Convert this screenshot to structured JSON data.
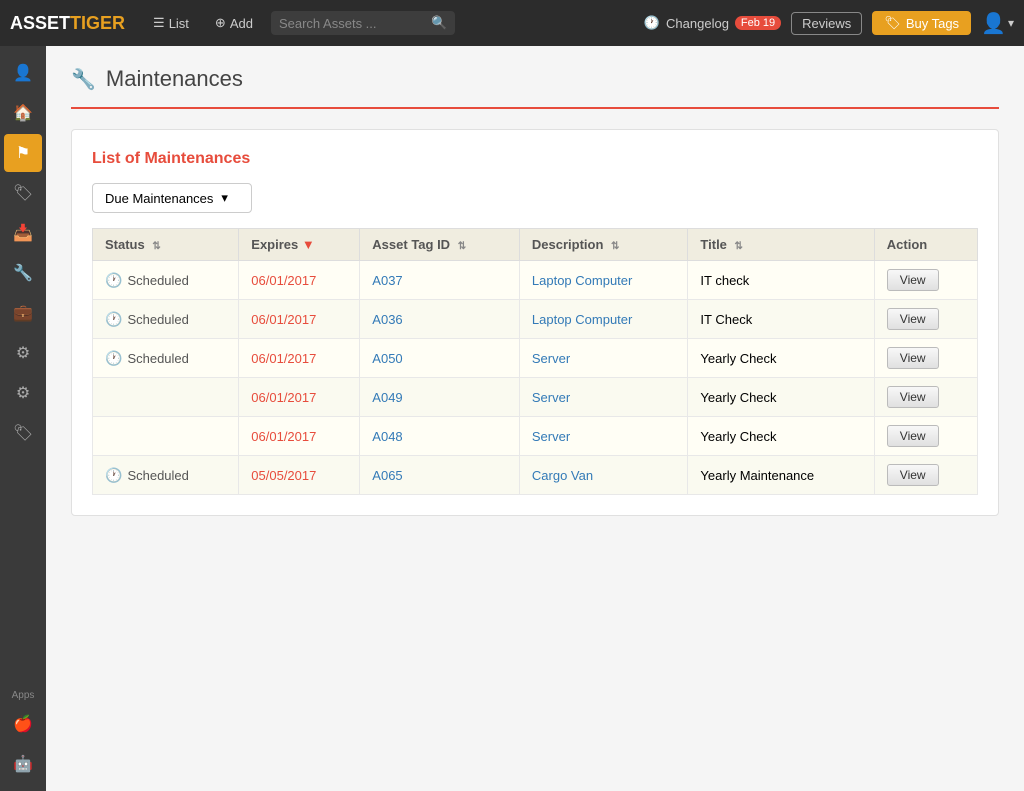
{
  "topNav": {
    "logo": {
      "part1": "ASSET",
      "part2": "TIGER"
    },
    "list_label": "List",
    "add_label": "Add",
    "search_placeholder": "Search Assets ...",
    "changelog_label": "Changelog",
    "feb_badge": "Feb 19",
    "reviews_label": "Reviews",
    "buy_tags_label": "Buy Tags"
  },
  "sidebar": {
    "icons": [
      {
        "name": "user-icon",
        "symbol": "👤",
        "active": false
      },
      {
        "name": "home-icon",
        "symbol": "🏠",
        "active": false
      },
      {
        "name": "flag-icon",
        "symbol": "⚑",
        "active": true
      },
      {
        "name": "tag-icon",
        "symbol": "🏷",
        "active": false
      },
      {
        "name": "inbox-icon",
        "symbol": "📥",
        "active": false
      },
      {
        "name": "wrench-icon",
        "symbol": "🔧",
        "active": false
      },
      {
        "name": "briefcase-icon",
        "symbol": "💼",
        "active": false
      },
      {
        "name": "settings-icon",
        "symbol": "⚙",
        "active": false
      },
      {
        "name": "gear-icon",
        "symbol": "⚙",
        "active": false
      },
      {
        "name": "label-icon",
        "symbol": "🏷",
        "active": false
      }
    ],
    "apps_label": "Apps",
    "apple_icon": "🍎",
    "android_icon": "🤖"
  },
  "page": {
    "title": "Maintenances",
    "card_title": "List of Maintenances",
    "dropdown_label": "Due Maintenances",
    "table": {
      "columns": [
        {
          "key": "status",
          "label": "Status",
          "sortable": true,
          "sort_active": false
        },
        {
          "key": "expires",
          "label": "Expires",
          "sortable": true,
          "sort_active": true
        },
        {
          "key": "asset_tag_id",
          "label": "Asset Tag ID",
          "sortable": true,
          "sort_active": false
        },
        {
          "key": "description",
          "label": "Description",
          "sortable": true,
          "sort_active": false
        },
        {
          "key": "title",
          "label": "Title",
          "sortable": true,
          "sort_active": false
        },
        {
          "key": "action",
          "label": "Action",
          "sortable": false,
          "sort_active": false
        }
      ],
      "rows": [
        {
          "status": "Scheduled",
          "has_status": true,
          "expires": "06/01/2017",
          "asset_tag_id": "A037",
          "description": "Laptop Computer",
          "title": "IT check",
          "action": "View"
        },
        {
          "status": "Scheduled",
          "has_status": true,
          "expires": "06/01/2017",
          "asset_tag_id": "A036",
          "description": "Laptop Computer",
          "title": "IT Check",
          "action": "View"
        },
        {
          "status": "Scheduled",
          "has_status": true,
          "expires": "06/01/2017",
          "asset_tag_id": "A050",
          "description": "Server",
          "title": "Yearly Check",
          "action": "View"
        },
        {
          "status": "",
          "has_status": false,
          "expires": "06/01/2017",
          "asset_tag_id": "A049",
          "description": "Server",
          "title": "Yearly Check",
          "action": "View"
        },
        {
          "status": "",
          "has_status": false,
          "expires": "06/01/2017",
          "asset_tag_id": "A048",
          "description": "Server",
          "title": "Yearly Check",
          "action": "View"
        },
        {
          "status": "Scheduled",
          "has_status": true,
          "expires": "05/05/2017",
          "asset_tag_id": "A065",
          "description": "Cargo Van",
          "title": "Yearly Maintenance",
          "action": "View"
        }
      ]
    }
  }
}
